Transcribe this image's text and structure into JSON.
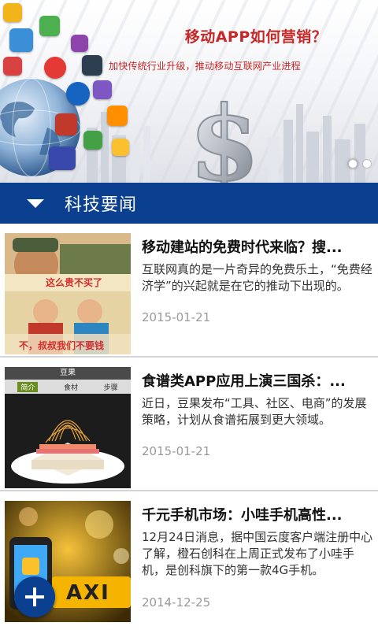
{
  "banner": {
    "title": "移动APP如何营销？",
    "subtitle": "加快传统行业升级，推动移动互联网产业进程",
    "pager": {
      "count": 2,
      "active_index": 0
    }
  },
  "section": {
    "label": "科技要闻",
    "icon": "caret-down-icon"
  },
  "news": [
    {
      "title": "移动建站的免费时代来临？搜...",
      "summary": "互联网真的是一片奇异的免费乐土，“免费经济学”的兴起就是在它的推动下出现的。",
      "date": "2015-01-21",
      "thumb_caption_top": "这么贵不买了",
      "thumb_caption_bottom": "不，叔叔我们不要钱"
    },
    {
      "title": "食谱类APP应用上演三国杀：...",
      "summary": "近日，豆果发布“工具、社区、电商”的发展策略，计划从食谱拓展到更大领域。",
      "date": "2015-01-21",
      "thumb_app_name": "豆果",
      "thumb_tabs": [
        "简介",
        "食材",
        "步骤"
      ]
    },
    {
      "title": "千元手机市场：小哇手机高性...",
      "summary": "12月24日消息，据中国云度客户端注册中心了解，橙石创科在上周正式发布了小哇手机，是创科旗下的第一款4G手机。",
      "date": "2014-12-25",
      "thumb_sign": "AXI"
    }
  ],
  "fab": {
    "icon": "plus-icon"
  },
  "colors": {
    "brand_blue": "#0b3f8f",
    "banner_text_red": "#c62828",
    "date_gray": "#9a9a9a"
  }
}
